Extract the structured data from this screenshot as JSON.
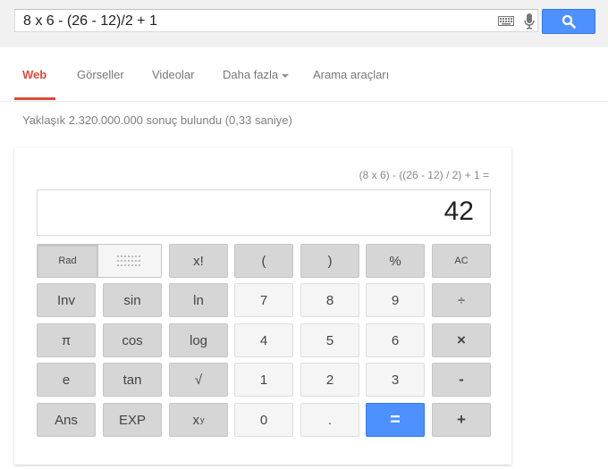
{
  "search": {
    "query": "8 x 6 - (26 - 12)/2 + 1",
    "keyboard_icon": "keyboard-icon",
    "mic_icon": "microphone-icon",
    "button_icon": "search-icon"
  },
  "tabs": [
    {
      "label": "Web",
      "active": true
    },
    {
      "label": "Görseller"
    },
    {
      "label": "Videolar"
    },
    {
      "label": "Daha fazla"
    },
    {
      "label": "Arama araçları"
    }
  ],
  "result_stats": "Yaklaşık 2.320.000.000 sonuç bulundu (0,33 saniye)",
  "calculator": {
    "expression": "(8 x 6) - ((26 - 12) / 2) + 1 =",
    "result": "42",
    "rad_label": "Rad",
    "keys": {
      "fact": "x!",
      "lparen": "(",
      "rparen": ")",
      "percent": "%",
      "clear": "AC",
      "inv": "Inv",
      "sin": "sin",
      "ln": "ln",
      "d7": "7",
      "d8": "8",
      "d9": "9",
      "div": "÷",
      "pi": "π",
      "cos": "cos",
      "log": "log",
      "d4": "4",
      "d5": "5",
      "d6": "6",
      "mul": "×",
      "e": "e",
      "tan": "tan",
      "sqrt": "√",
      "d1": "1",
      "d2": "2",
      "d3": "3",
      "sub": "-",
      "ans": "Ans",
      "exp": "EXP",
      "pow_base": "x",
      "pow_exp": "y",
      "d0": "0",
      "dot": ".",
      "eq": "=",
      "add": "+"
    }
  },
  "colors": {
    "accent_red": "#dd4b39",
    "blue_button": "#4d90fe",
    "key_gray": "#d6d6d6",
    "key_light": "#f5f5f5"
  }
}
